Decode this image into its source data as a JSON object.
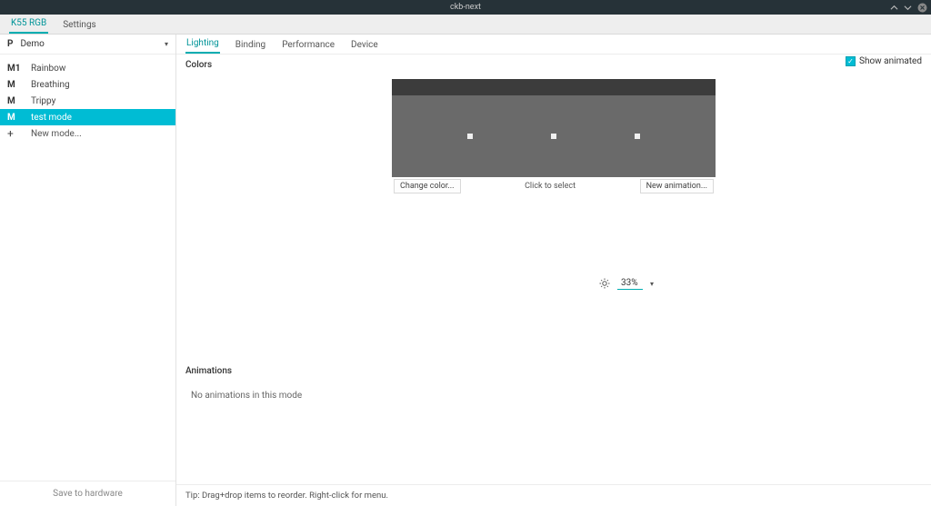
{
  "window": {
    "title": "ckb-next"
  },
  "top_tabs": {
    "items": [
      "K55 RGB",
      "Settings"
    ],
    "active_index": 0
  },
  "profile": {
    "prefix": "P",
    "name": "Demo"
  },
  "modes": [
    {
      "key": "M1",
      "label": "Rainbow"
    },
    {
      "key": "M",
      "label": "Breathing"
    },
    {
      "key": "M",
      "label": "Trippy"
    },
    {
      "key": "M",
      "label": "test mode"
    }
  ],
  "modes_selected_index": 3,
  "new_mode_label": "New mode...",
  "save_to_hw": "Save to hardware",
  "sub_tabs": {
    "items": [
      "Lighting",
      "Binding",
      "Performance",
      "Device"
    ],
    "active_index": 0
  },
  "colors": {
    "section_title": "Colors",
    "show_animated_label": "Show animated",
    "show_animated_checked": true,
    "change_color_btn": "Change color...",
    "click_select": "Click to select",
    "new_animation_btn": "New animation..."
  },
  "brightness": {
    "value": "33%"
  },
  "animations": {
    "section_title": "Animations",
    "empty_text": "No animations in this mode"
  },
  "tip": "Tip: Drag+drop items to reorder. Right-click for menu."
}
